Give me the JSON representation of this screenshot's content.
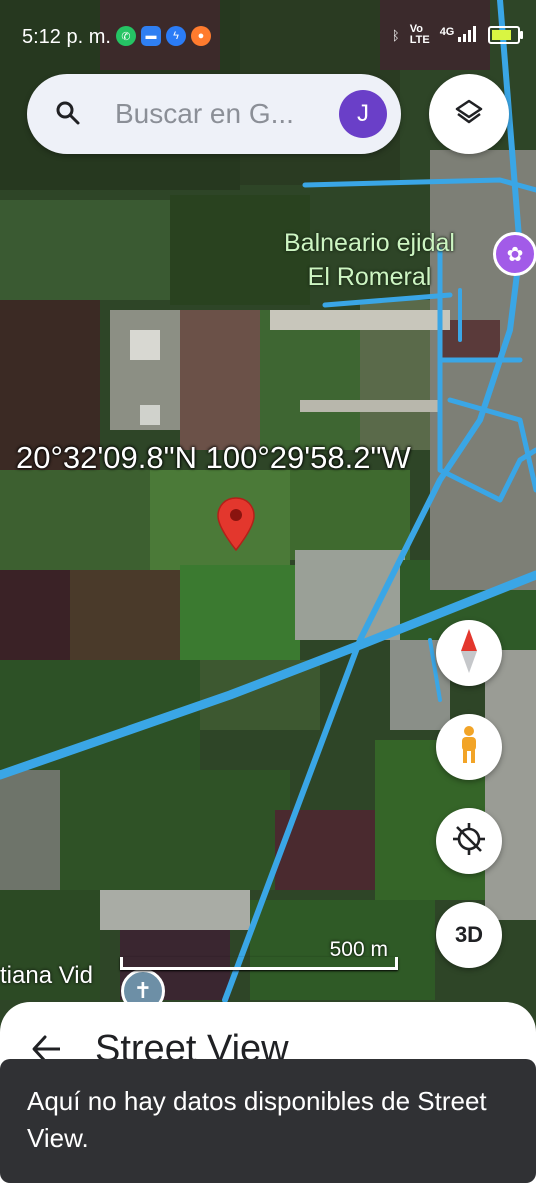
{
  "status_bar": {
    "time": "5:12 p. m.",
    "network_top": "Vo",
    "network_bottom": "LTE",
    "cell_type": "4G",
    "battery_level": 0.8
  },
  "search": {
    "placeholder": "Buscar en G...",
    "avatar_initial": "J"
  },
  "map": {
    "place_label": "Balneario ejidal\nEl Romeral",
    "coordinates": "20°32'09.8\"N 100°29'58.2\"W",
    "lower_label": "tiana Vid",
    "scale_label": "500 m",
    "road_color": "#3aa6e6",
    "pin_color": "#e3372d"
  },
  "controls": {
    "three_d_label": "3D"
  },
  "sheet": {
    "title": "Street View"
  },
  "toast": {
    "message": "Aquí no hay datos disponibles de Street View."
  }
}
